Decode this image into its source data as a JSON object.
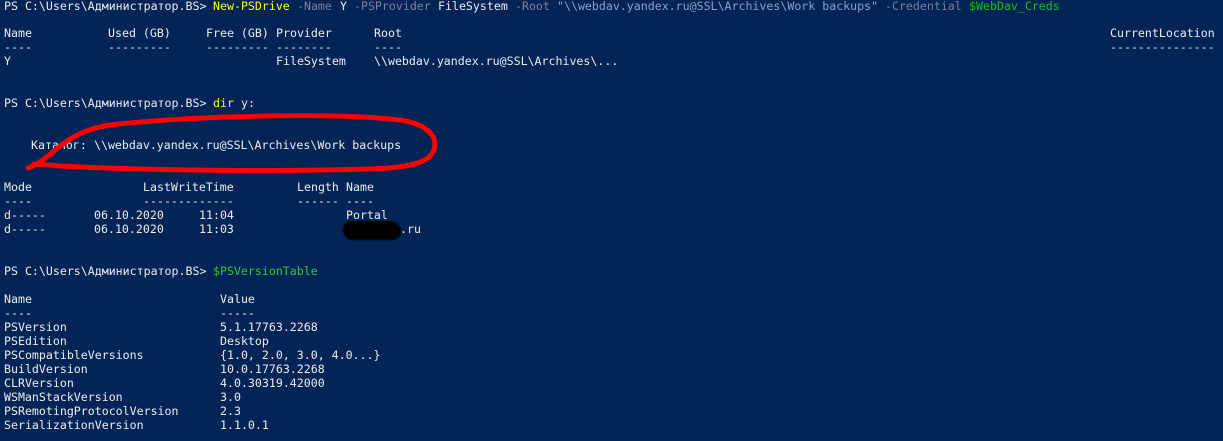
{
  "prompt": "PS C:\\Users\\Администратор.BS> ",
  "cmd1": {
    "cmdlet": "New-PSDrive",
    "p_name": " -Name ",
    "v_name": "Y",
    "p_provider": " -PSProvider ",
    "v_provider": "FileSystem",
    "p_root": " -Root ",
    "v_root": "\"\\\\webdav.yandex.ru@SSL\\Archives\\Work backups\"",
    "p_cred": " -Credential ",
    "v_cred": "$WebDav_Creds"
  },
  "drive_table": {
    "headers": {
      "name": "Name",
      "used": "Used (GB)",
      "free": "Free (GB)",
      "provider": "Provider",
      "root": "Root",
      "current": "CurrentLocation"
    },
    "underlines": {
      "name": "----",
      "used": "---------",
      "free": "---------",
      "provider": "--------",
      "root": "----",
      "current": "---------------"
    },
    "row": {
      "name": "Y",
      "provider": "FileSystem",
      "root": "\\\\webdav.yandex.ru@SSL\\Archives\\..."
    }
  },
  "cmd2": {
    "cmd": "dir",
    "arg": " y:"
  },
  "catalog": {
    "label": "Каталог:",
    "path": " \\\\webdav.yandex.ru@SSL\\Archives\\Work backups"
  },
  "dir_table": {
    "headers": {
      "mode": "Mode",
      "lastwrite": "LastWriteTime",
      "length": "Length",
      "name": "Name"
    },
    "underlines": {
      "mode": "----",
      "lastwrite": "-------------",
      "length": "------",
      "name": "----"
    },
    "rows": [
      {
        "mode": "d-----",
        "date": "06.10.2020",
        "time": "11:04",
        "name": "Portal"
      },
      {
        "mode": "d-----",
        "date": "06.10.2020",
        "time": "11:03",
        "name": ".ru"
      }
    ]
  },
  "cmd3": {
    "var": "$PSVersionTable"
  },
  "version_table": {
    "headers": {
      "name": "Name",
      "value": "Value"
    },
    "underlines": {
      "name": "----",
      "value": "-----"
    },
    "rows": [
      {
        "name": "PSVersion",
        "value": "5.1.17763.2268"
      },
      {
        "name": "PSEdition",
        "value": "Desktop"
      },
      {
        "name": "PSCompatibleVersions",
        "value": "{1.0, 2.0, 3.0, 4.0...}"
      },
      {
        "name": "BuildVersion",
        "value": "10.0.17763.2268"
      },
      {
        "name": "CLRVersion",
        "value": "4.0.30319.42000"
      },
      {
        "name": "WSManStackVersion",
        "value": "3.0"
      },
      {
        "name": "PSRemotingProtocolVersion",
        "value": "2.3"
      },
      {
        "name": "SerializationVersion",
        "value": "1.1.0.1"
      }
    ]
  },
  "colors": {
    "background": "#012456",
    "text": "#eeedf0",
    "cmdlet": "#ffff00",
    "parameter": "#7f7f9c",
    "string": "#8aa0c8",
    "variable": "#13c413",
    "annotation": "#ff0000"
  }
}
